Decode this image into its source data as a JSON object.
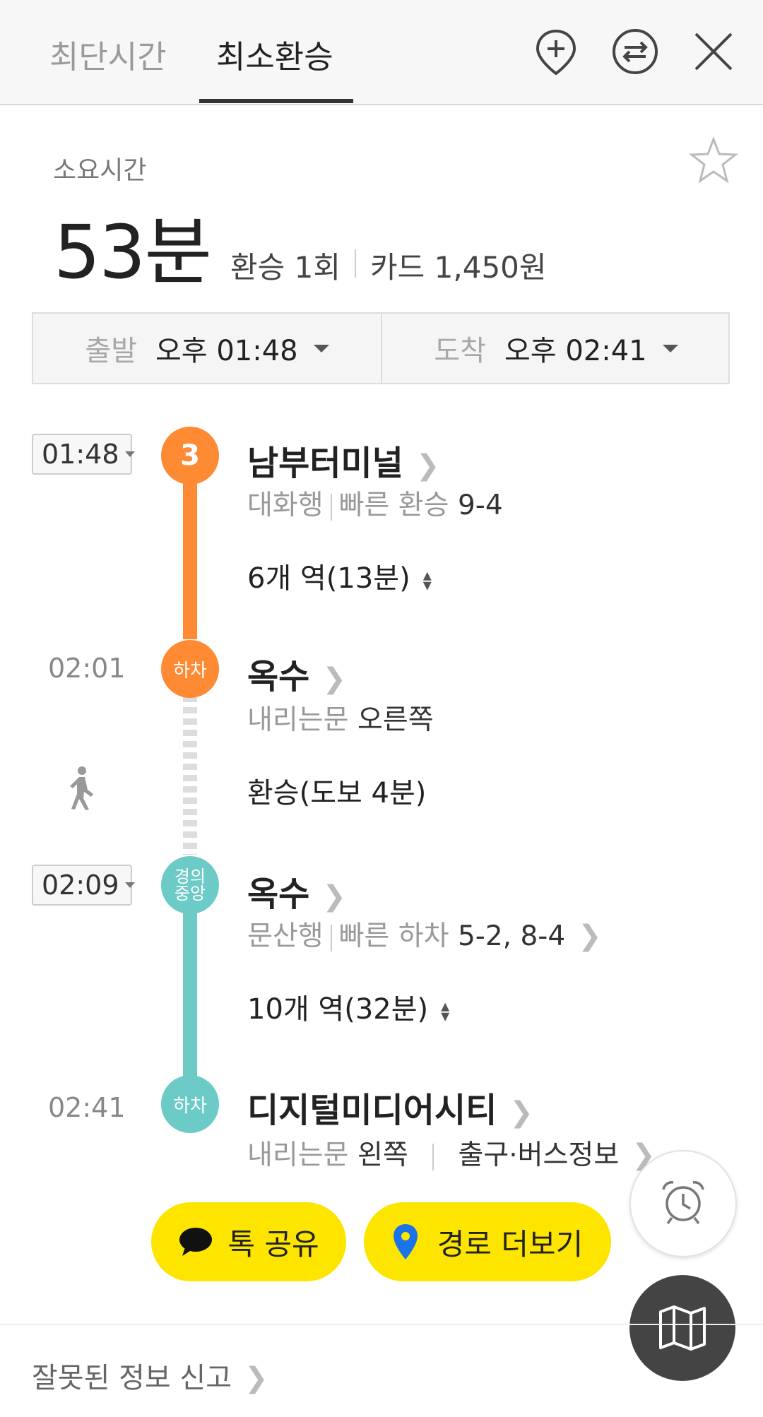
{
  "tabs": [
    {
      "label": "최단시간",
      "active": false
    },
    {
      "label": "최소환승",
      "active": true
    }
  ],
  "icons": [
    "add-location-icon",
    "swap-icon",
    "close-icon",
    "star-icon",
    "walking-icon",
    "alarm-clock-icon",
    "map-icon",
    "chat-bubble-icon",
    "location-pin-icon"
  ],
  "summary": {
    "duration_label": "소요시간",
    "duration": "53분",
    "transfers": "환승 1회",
    "fare": "카드 1,450원"
  },
  "schedule": {
    "departure_label": "출발",
    "departure_time": "오후 01:48",
    "arrival_label": "도착",
    "arrival_time": "오후 02:41"
  },
  "route": [
    {
      "time": "01:48",
      "badge": "3",
      "station": "남부터미널",
      "direction": "대화행",
      "tip_label": "빠른 환승",
      "tip_value": "9-4",
      "stations": "6개 역(13분)",
      "color": "#ff8a34"
    },
    {
      "time": "02:01",
      "badge": "하차",
      "station": "옥수",
      "door_label": "내리는문",
      "door_side": "오른쪽"
    },
    {
      "walk": "환승(도보 4분)"
    },
    {
      "time": "02:09",
      "badge_line1": "경의",
      "badge_line2": "중앙",
      "station": "옥수",
      "direction": "문산행",
      "tip_label": "빠른 하차",
      "tip_value": "5-2, 8-4",
      "stations": "10개 역(32분)",
      "color": "#6ccbc6"
    },
    {
      "time": "02:41",
      "badge": "하차",
      "station": "디지털미디어시티",
      "door_label": "내리는문",
      "door_side": "왼쪽",
      "exit_info": "출구·버스정보"
    }
  ],
  "buttons": {
    "share": "톡 공유",
    "more_routes": "경로 더보기"
  },
  "footer": {
    "report": "잘못된 정보 신고"
  },
  "colors": {
    "line3": "#ff8a34",
    "gyeongui": "#6ccbc6",
    "kakao_yellow": "#fde500"
  }
}
